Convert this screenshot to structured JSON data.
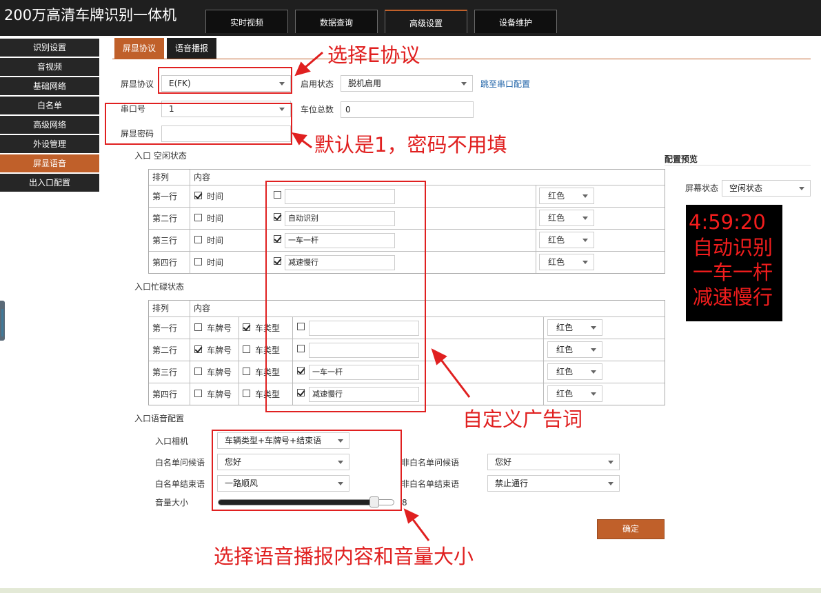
{
  "app": {
    "title": "200万高清车牌识别一体机"
  },
  "top_nav": [
    {
      "label": "实时视频",
      "active": false
    },
    {
      "label": "数据查询",
      "active": false
    },
    {
      "label": "高级设置",
      "active": true
    },
    {
      "label": "设备维护",
      "active": false
    }
  ],
  "sidebar": {
    "items": [
      {
        "label": "识别设置",
        "active": false
      },
      {
        "label": "音视频",
        "active": false
      },
      {
        "label": "基础网络",
        "active": false
      },
      {
        "label": "白名单",
        "active": false
      },
      {
        "label": "高级网络",
        "active": false
      },
      {
        "label": "外设管理",
        "active": false
      },
      {
        "label": "屏显语音",
        "active": true
      },
      {
        "label": "出入口配置",
        "active": false
      }
    ]
  },
  "tabs": [
    {
      "label": "屏显协议",
      "active": true
    },
    {
      "label": "语音播报",
      "active": false
    }
  ],
  "form": {
    "protocol_label": "屏显协议",
    "protocol_value": "E(FK)",
    "enable_label": "启用状态",
    "enable_value": "脱机启用",
    "serial_link": "跳至串口配置",
    "serial_label": "串口号",
    "serial_value": "1",
    "spaces_label": "车位总数",
    "spaces_value": "0",
    "password_label": "屏显密码",
    "password_value": ""
  },
  "idle": {
    "section_title": "入口 空闲状态",
    "header_order": "排列",
    "header_content": "内容",
    "rows": [
      {
        "row": "第一行",
        "time_label": "时间",
        "time_checked": true,
        "custom_checked": false,
        "custom_text": "",
        "color": "红色"
      },
      {
        "row": "第二行",
        "time_label": "时间",
        "time_checked": false,
        "custom_checked": true,
        "custom_text": "自动识别",
        "color": "红色"
      },
      {
        "row": "第三行",
        "time_label": "时间",
        "time_checked": false,
        "custom_checked": true,
        "custom_text": "一车一杆",
        "color": "红色"
      },
      {
        "row": "第四行",
        "time_label": "时间",
        "time_checked": false,
        "custom_checked": true,
        "custom_text": "减速慢行",
        "color": "红色"
      }
    ]
  },
  "busy": {
    "section_title": "入口忙碌状态",
    "header_order": "排列",
    "header_content": "内容",
    "rows": [
      {
        "row": "第一行",
        "plate_label": "车牌号",
        "plate_checked": false,
        "type_label": "车类型",
        "type_checked": true,
        "custom_checked": false,
        "custom_text": "",
        "color": "红色"
      },
      {
        "row": "第二行",
        "plate_label": "车牌号",
        "plate_checked": true,
        "type_label": "车类型",
        "type_checked": false,
        "custom_checked": false,
        "custom_text": "",
        "color": "红色"
      },
      {
        "row": "第三行",
        "plate_label": "车牌号",
        "plate_checked": false,
        "type_label": "车类型",
        "type_checked": false,
        "custom_checked": true,
        "custom_text": "一车一杆",
        "color": "红色"
      },
      {
        "row": "第四行",
        "plate_label": "车牌号",
        "plate_checked": false,
        "type_label": "车类型",
        "type_checked": false,
        "custom_checked": true,
        "custom_text": "减速慢行",
        "color": "红色"
      }
    ]
  },
  "voice": {
    "section_title": "入口语音配置",
    "camera_label": "入口相机",
    "camera_value": "车辆类型+车牌号+结束语",
    "wl_greeting_label": "白名单问候语",
    "wl_greeting_value": "您好",
    "nwl_greeting_label": "非白名单问候语",
    "nwl_greeting_value": "您好",
    "wl_end_label": "白名单结束语",
    "wl_end_value": "一路顺风",
    "nwl_end_label": "非白名单结束语",
    "nwl_end_value": "禁止通行",
    "volume_label": "音量大小",
    "volume_value": "8",
    "volume_fraction": 0.9,
    "confirm_label": "确定"
  },
  "preview": {
    "title": "配置预览",
    "screen_state_label": "屏幕状态",
    "screen_state_value": "空闲状态",
    "led_lines": [
      "4:59:20",
      "自动识别",
      "一车一杆",
      "减速慢行"
    ]
  },
  "annotations": {
    "protocol_note": "选择E协议",
    "password_note": "默认是1，密码不用填",
    "ad_note": "自定义广告词",
    "voice_note": "选择语音播报内容和音量大小"
  },
  "colors": {
    "accent": "#c0602a",
    "annotation": "#e02020",
    "led_text": "#f31d1d"
  }
}
